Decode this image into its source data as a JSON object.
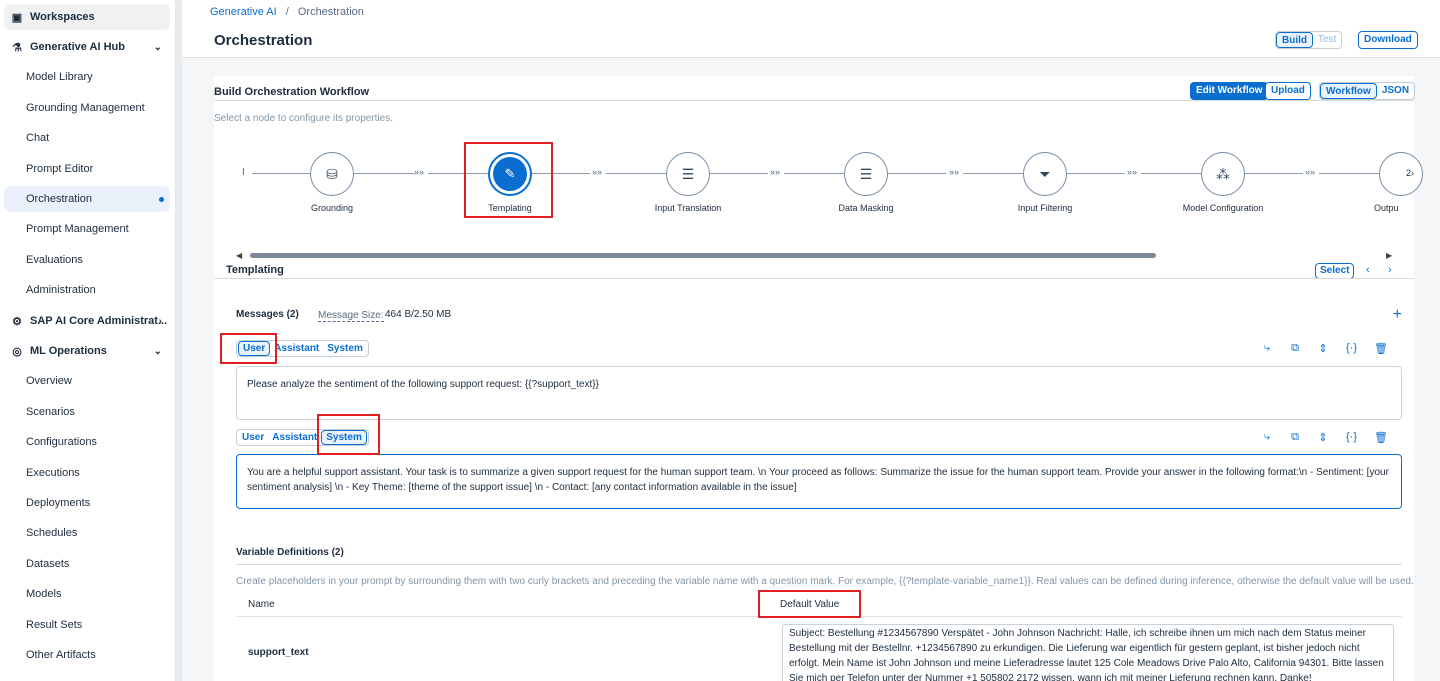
{
  "sidebar": {
    "items": [
      {
        "label": "Workspaces",
        "icon": "workspace-icon"
      },
      {
        "label": "Generative AI Hub",
        "icon": "ai-hub-icon"
      },
      {
        "label": "Model Library"
      },
      {
        "label": "Grounding Management"
      },
      {
        "label": "Chat"
      },
      {
        "label": "Prompt Editor"
      },
      {
        "label": "Orchestration"
      },
      {
        "label": "Prompt Management"
      },
      {
        "label": "Evaluations"
      },
      {
        "label": "Administration"
      },
      {
        "label": "SAP AI Core Administrat...",
        "icon": "admin-icon"
      },
      {
        "label": "ML Operations",
        "icon": "ml-ops-icon"
      },
      {
        "label": "Overview"
      },
      {
        "label": "Scenarios"
      },
      {
        "label": "Configurations"
      },
      {
        "label": "Executions"
      },
      {
        "label": "Deployments"
      },
      {
        "label": "Schedules"
      },
      {
        "label": "Datasets"
      },
      {
        "label": "Models"
      },
      {
        "label": "Result Sets"
      },
      {
        "label": "Other Artifacts"
      }
    ]
  },
  "header": {
    "breadcrumb_root": "Generative AI",
    "breadcrumb_sep": "/",
    "breadcrumb_current": "Orchestration",
    "title": "Orchestration",
    "build": "Build",
    "test": "Test",
    "download": "Download"
  },
  "workflow": {
    "title": "Build Orchestration Workflow",
    "hint": "Select a node to configure its properties.",
    "edit": "Edit Workflow",
    "upload": "Upload",
    "view_workflow": "Workflow",
    "view_json": "JSON",
    "start_marker": "I",
    "arrow_glyph": "»»",
    "more": "2›",
    "nodes": [
      {
        "label": "Grounding",
        "icon": "database-icon"
      },
      {
        "label": "Templating",
        "icon": "template-edit-icon"
      },
      {
        "label": "Input Translation",
        "icon": "translation-icon"
      },
      {
        "label": "Data Masking",
        "icon": "masking-icon"
      },
      {
        "label": "Input Filtering",
        "icon": "filter-icon"
      },
      {
        "label": "Model Configuration",
        "icon": "model-config-icon"
      },
      {
        "label": "Outpu",
        "icon": "output-icon"
      }
    ]
  },
  "templating": {
    "title": "Templating",
    "select": "Select",
    "messages_label": "Messages (2)",
    "message_size_label": "Message Size:",
    "message_size_value": "464 B/2.50 MB",
    "role_user": "User",
    "role_assistant": "Assistant",
    "role_system": "System",
    "message1": "Please analyze the sentiment of the following support request: {{?support_text}}",
    "message2": "You are a helpful support assistant. Your task is to summarize a given support request for the human support team. \\n Your proceed as follows: Summarize the issue for the human support team. Provide your answer in the following format:\\n - Sentiment: [your sentiment analysis] \\n - Key Theme: [theme of the support issue] \\n - Contact: [any contact information available in the issue]",
    "variables_title": "Variable Definitions (2)",
    "variables_hint": "Create placeholders in your prompt by surrounding them with two curly brackets and preceding the variable name with a question mark. For example, {{?template-variable_name1}}. Real values can be defined during inference, otherwise the default value will be used.",
    "col_name": "Name",
    "col_default": "Default Value",
    "var_name": "support_text",
    "var_value": "Subject: Bestellung #1234567890 Verspätet - John Johnson Nachricht: Halle, ich schreibe ihnen um mich nach dem Status meiner Bestellung mit der Bestellnr. +1234567890 zu erkundigen. Die Lieferung war eigentlich für gestern geplant, ist bisher jedoch nicht erfolgt. Mein Name ist John Johnson und meine Lieferadresse lautet 125 Cole Meadows Drive Palo Alto, California 94301. Bitte lassen Sie mich per Telefon unter der Nummer +1 505802 2172 wissen, wann ich mit meiner Lieferung rechnen kann. Danke!"
  },
  "colors": {
    "accent": "#0a6ed1",
    "highlight": "#e02020"
  }
}
